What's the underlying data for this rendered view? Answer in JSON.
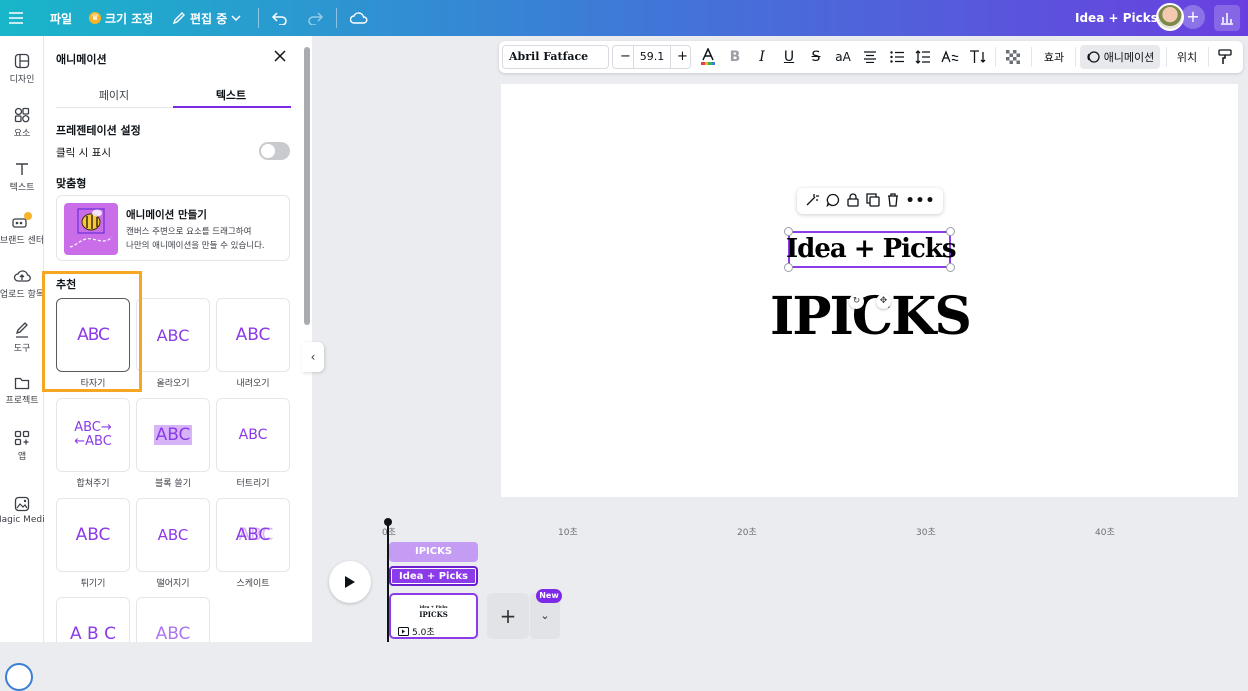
{
  "topbar": {
    "file_label": "파일",
    "resize_label": "크기 조정",
    "editing_label": "편집 중",
    "design_title": "Idea + Picks"
  },
  "rail": {
    "items": [
      {
        "label": "디자인",
        "icon": "layout-icon"
      },
      {
        "label": "요소",
        "icon": "elements-icon"
      },
      {
        "label": "텍스트",
        "icon": "text-icon"
      },
      {
        "label": "브랜드 센터",
        "icon": "brand-icon"
      },
      {
        "label": "업로드 항목",
        "icon": "upload-icon"
      },
      {
        "label": "도구",
        "icon": "draw-icon"
      },
      {
        "label": "프로젝트",
        "icon": "folder-icon"
      },
      {
        "label": "앱",
        "icon": "apps-icon"
      },
      {
        "label": "Magic Media",
        "icon": "magic-media-icon"
      }
    ]
  },
  "panel": {
    "title": "애니메이션",
    "tabs": [
      "페이지",
      "텍스트"
    ],
    "active_tab": "텍스트",
    "presentation_heading": "프레젠테이션 설정",
    "click_show_label": "클릭 시 표시",
    "custom_heading": "맞춤형",
    "create_title": "애니메이션 만들기",
    "create_desc_1": "캔버스 주변으로 요소를 드래그하여",
    "create_desc_2": "나만의 애니메이션을 만들 수 있습니다.",
    "recommended_heading": "추천",
    "animations": [
      {
        "preview": "ABC",
        "label": "타자기"
      },
      {
        "preview": "ABC",
        "label": "올라오기"
      },
      {
        "preview": "ABC",
        "label": "내려오기"
      },
      {
        "preview": "ABC→ ←ABC",
        "label": "합쳐주기"
      },
      {
        "preview": "ABC",
        "label": "블록 쓸기"
      },
      {
        "preview": "ABC",
        "label": "터트리기"
      },
      {
        "preview": "ABC",
        "label": "튀기기"
      },
      {
        "preview": "ABC",
        "label": "떨어지기"
      },
      {
        "preview": "ABC",
        "label": "스케이트"
      },
      {
        "preview": "A B C",
        "label": ""
      },
      {
        "preview": "ABC",
        "label": ""
      }
    ]
  },
  "toolbar": {
    "font": "Abril Fatface",
    "size": "59.1",
    "effects_label": "효과",
    "animation_label": "애니메이션",
    "position_label": "위치"
  },
  "canvas": {
    "text_small": "Idea + Picks",
    "text_large": "IPICKS"
  },
  "timeline": {
    "ticks": [
      "0초",
      "10초",
      "20초",
      "30초",
      "40초"
    ],
    "track_1": "IPICKS",
    "track_2": "Idea + Picks",
    "clip_mini_1": "Idea + Picks",
    "clip_mini_2": "IPICKS",
    "clip_duration": "5.0초",
    "new_badge": "New"
  }
}
